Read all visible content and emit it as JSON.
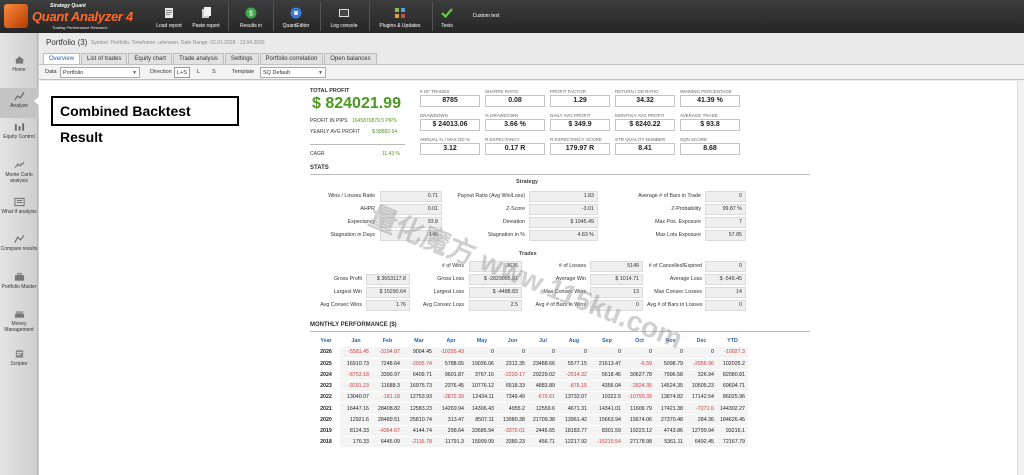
{
  "app": {
    "logo_top": "Strategy Quant",
    "logo_name": "Quant Analyzer 4",
    "logo_tagline": "Trading Performance Research"
  },
  "toolbar": [
    {
      "label": "Load report",
      "icon": "folder-icon"
    },
    {
      "label": "Paste report",
      "icon": "paste-icon"
    },
    {
      "label": "Results in",
      "icon": "results-icon"
    },
    {
      "label": "QuantEditor",
      "icon": "editor-icon"
    },
    {
      "label": "Log console",
      "icon": "console-icon"
    },
    {
      "label": "Plugins & Updates",
      "icon": "plugins-icon"
    },
    {
      "label": "Tests",
      "icon": "check-icon"
    },
    {
      "label": "Custom test",
      "icon": ""
    }
  ],
  "sidebar": [
    {
      "label": "Home",
      "icon": "home-icon"
    },
    {
      "label": "Analyze",
      "icon": "chart-icon"
    },
    {
      "label": "Equity Control",
      "icon": "equity-icon"
    },
    {
      "label": "Monte Carlo analysis",
      "icon": "montecarlo-icon"
    },
    {
      "label": "What If analysis",
      "icon": "whatif-icon"
    },
    {
      "label": "Compare results",
      "icon": "compare-icon"
    },
    {
      "label": "Portfolio Master",
      "icon": "portfolio-icon"
    },
    {
      "label": "Money Management",
      "icon": "money-icon"
    },
    {
      "label": "Scripter",
      "icon": "scripter-icon"
    }
  ],
  "portfolio": {
    "title": "Portfolio (3)",
    "subtitle": "Symbol: Portfolio, Timeframe: unknown, Date Range: 02.01.2018 - 13.04.2026"
  },
  "tabs": [
    "Overview",
    "List of trades",
    "Equity chart",
    "Trade analysis",
    "Settings",
    "Portfolio correlation",
    "Open balances"
  ],
  "filters": {
    "data_label": "Data",
    "data_value": "Portfolio",
    "direction_label": "Direction",
    "direction_options": [
      "L+S",
      "L",
      "S"
    ],
    "template_label": "Template",
    "template_value": "SQ Default"
  },
  "annotation": "Combined Backtest Result",
  "summary": {
    "total_profit_label": "TOTAL PROFIT",
    "total_profit": "$ 824021.99",
    "profit_pips_label": "PROFIT IN PIPS",
    "profit_pips": "1645870879.5 PIPS",
    "yearly_avg_label": "YEARLY AVG PROFIT",
    "yearly_avg": "$ 98882.64",
    "cagr_label": "CAGR",
    "cagr": "11.43 %"
  },
  "metrics": [
    {
      "label": "# OF TRADES",
      "value": "8785"
    },
    {
      "label": "SHARPE RATIO",
      "value": "0.08"
    },
    {
      "label": "PROFIT FACTOR",
      "value": "1.29"
    },
    {
      "label": "RETURN / DD RATIO",
      "value": "34.32"
    },
    {
      "label": "WINNING PERCENTAGE",
      "value": "41.39 %"
    },
    {
      "label": "DRAWDOWN",
      "value": "$ 24013.06"
    },
    {
      "label": "% DRAWDOWN",
      "value": "3.66 %"
    },
    {
      "label": "DAILY AVG PROFIT",
      "value": "$ 349.9"
    },
    {
      "label": "MONTHLY AVG PROFIT",
      "value": "$ 8240.22"
    },
    {
      "label": "AVERAGE TRADE",
      "value": "$ 93.8"
    },
    {
      "label": "ANNUAL % / MAX DD %",
      "value": "3.12"
    },
    {
      "label": "R EXPECTANCY",
      "value": "0.17 R"
    },
    {
      "label": "R EXPECTANCY SCORE",
      "value": "179.97 R"
    },
    {
      "label": "STR QUALITY NUMBER",
      "value": "8.41"
    },
    {
      "label": "SQN SCORE",
      "value": "8.68"
    }
  ],
  "stats_title": "STATS",
  "strategy_title": "Strategy",
  "strategy": [
    [
      {
        "l": "Wins / Losses Ratio",
        "v": "0.71"
      },
      {
        "l": "Payout Ratio (Avg Win/Loss)",
        "v": "1.83"
      },
      {
        "l": "Average # of Bars in Trade",
        "v": "0"
      }
    ],
    [
      {
        "l": "AHPR",
        "v": "0.01"
      },
      {
        "l": "Z-Score",
        "v": "-3.01"
      },
      {
        "l": "Z-Probability",
        "v": "99.87 %"
      }
    ],
    [
      {
        "l": "Expectancy",
        "v": "93.8"
      },
      {
        "l": "Deviation",
        "v": "$ 1045.49"
      },
      {
        "l": "Max Pos. Exposure",
        "v": "7"
      }
    ],
    [
      {
        "l": "Stagnation in Days",
        "v": "146"
      },
      {
        "l": "Stagnation in %",
        "v": "4.83 %"
      },
      {
        "l": "Max Lots Exposure",
        "v": "57.85"
      }
    ]
  ],
  "trades_title": "Trades",
  "trades": [
    [
      {
        "l": "",
        "v": ""
      },
      {
        "l": "# of Wins",
        "v": "3636"
      },
      {
        "l": "# of Losses",
        "v": "5149"
      },
      {
        "l": "# of Cancelled/Expired",
        "v": "0"
      }
    ],
    [
      {
        "l": "Gross Profit",
        "v": "$ 3653117.8"
      },
      {
        "l": "Gross Loss",
        "v": "$ -2829095.81"
      },
      {
        "l": "Average Win",
        "v": "$ 1014.71"
      },
      {
        "l": "Average Loss",
        "v": "$ -549.45"
      }
    ],
    [
      {
        "l": "Largest Win",
        "v": "$ 15290.64"
      },
      {
        "l": "Largest Loss",
        "v": "$ -4488.83"
      },
      {
        "l": "Max Consec Wins",
        "v": "13"
      },
      {
        "l": "Max Consec Losses",
        "v": "14"
      }
    ],
    [
      {
        "l": "Avg Consec Wins",
        "v": "1.76"
      },
      {
        "l": "Avg Consec Loss",
        "v": "2.5"
      },
      {
        "l": "Avg # of Bars in Wins",
        "v": "0"
      },
      {
        "l": "Avg # of Bars in Losses",
        "v": "0"
      }
    ]
  ],
  "monthly_title": "MONTHLY PERFORMANCE ($)",
  "monthly_headers": [
    "Year",
    "Jan",
    "Feb",
    "Mar",
    "Apr",
    "May",
    "Jun",
    "Jul",
    "Aug",
    "Sep",
    "Oct",
    "Nov",
    "Dec",
    "YTD"
  ],
  "monthly_rows": [
    [
      "2026",
      "-5581.45",
      "-3194.87",
      "9004.45",
      "-10255.43",
      "0",
      "0",
      "0",
      "0",
      "0",
      "0",
      "0",
      "0",
      "-10027.3"
    ],
    [
      "2025",
      "16910.73",
      "7248.64",
      "-2005.74",
      "5788.65",
      "19036.06",
      "2312.35",
      "23488.66",
      "5577.15",
      "21613.47",
      "-6.59",
      "5098.79",
      "-2956.96",
      "102025.2"
    ],
    [
      "2024",
      "-8753.18",
      "3390.97",
      "6409.71",
      "9601.87",
      "3767.16",
      "-2220.17",
      "29229.02",
      "-2914.32",
      "5618.45",
      "30627.78",
      "7996.58",
      "326.94",
      "82080.81"
    ],
    [
      "2023",
      "-9291.23",
      "11688.3",
      "16975.73",
      "2376.45",
      "10776.12",
      "6518.33",
      "4883.89",
      "-876.15",
      "4356.04",
      "-2824.35",
      "14524.35",
      "10505.23",
      "69604.71"
    ],
    [
      "2022",
      "13040.07",
      "-181.18",
      "12753.93",
      "-2872.39",
      "12434.11",
      "7349.49",
      "-679.61",
      "13732.07",
      "10322.5",
      "-10790.39",
      "13874.82",
      "17142.54",
      "86025.96"
    ],
    [
      "2021",
      "16447.16",
      "28408.82",
      "12583.23",
      "14269.94",
      "14306.43",
      "4955.2",
      "12559.6",
      "4671.31",
      "14341.01",
      "11609.79",
      "17421.38",
      "-7271.6",
      "144302.27"
    ],
    [
      "2020",
      "12921.6",
      "28489.51",
      "25810.74",
      "313.47",
      "8507.11",
      "13980.38",
      "21709.38",
      "13961.42",
      "15663.94",
      "15674.06",
      "27370.48",
      "284.36",
      "184626.45"
    ],
    [
      "2019",
      "8124.33",
      "-4364.67",
      "4144.74",
      "298.64",
      "33685.94",
      "-3370.01",
      "2445.65",
      "18183.77",
      "8301.59",
      "19223.12",
      "4743.86",
      "12799.94",
      "93216.1"
    ],
    [
      "2018",
      "176.33",
      "6445.09",
      "-2116.78",
      "11791.3",
      "15999.99",
      "3380.23",
      "456.71",
      "12217.92",
      "-15215.54",
      "27178.98",
      "5361.11",
      "6492.45",
      "72167.79"
    ]
  ],
  "watermark": "量化魔方 www.115ku.com"
}
